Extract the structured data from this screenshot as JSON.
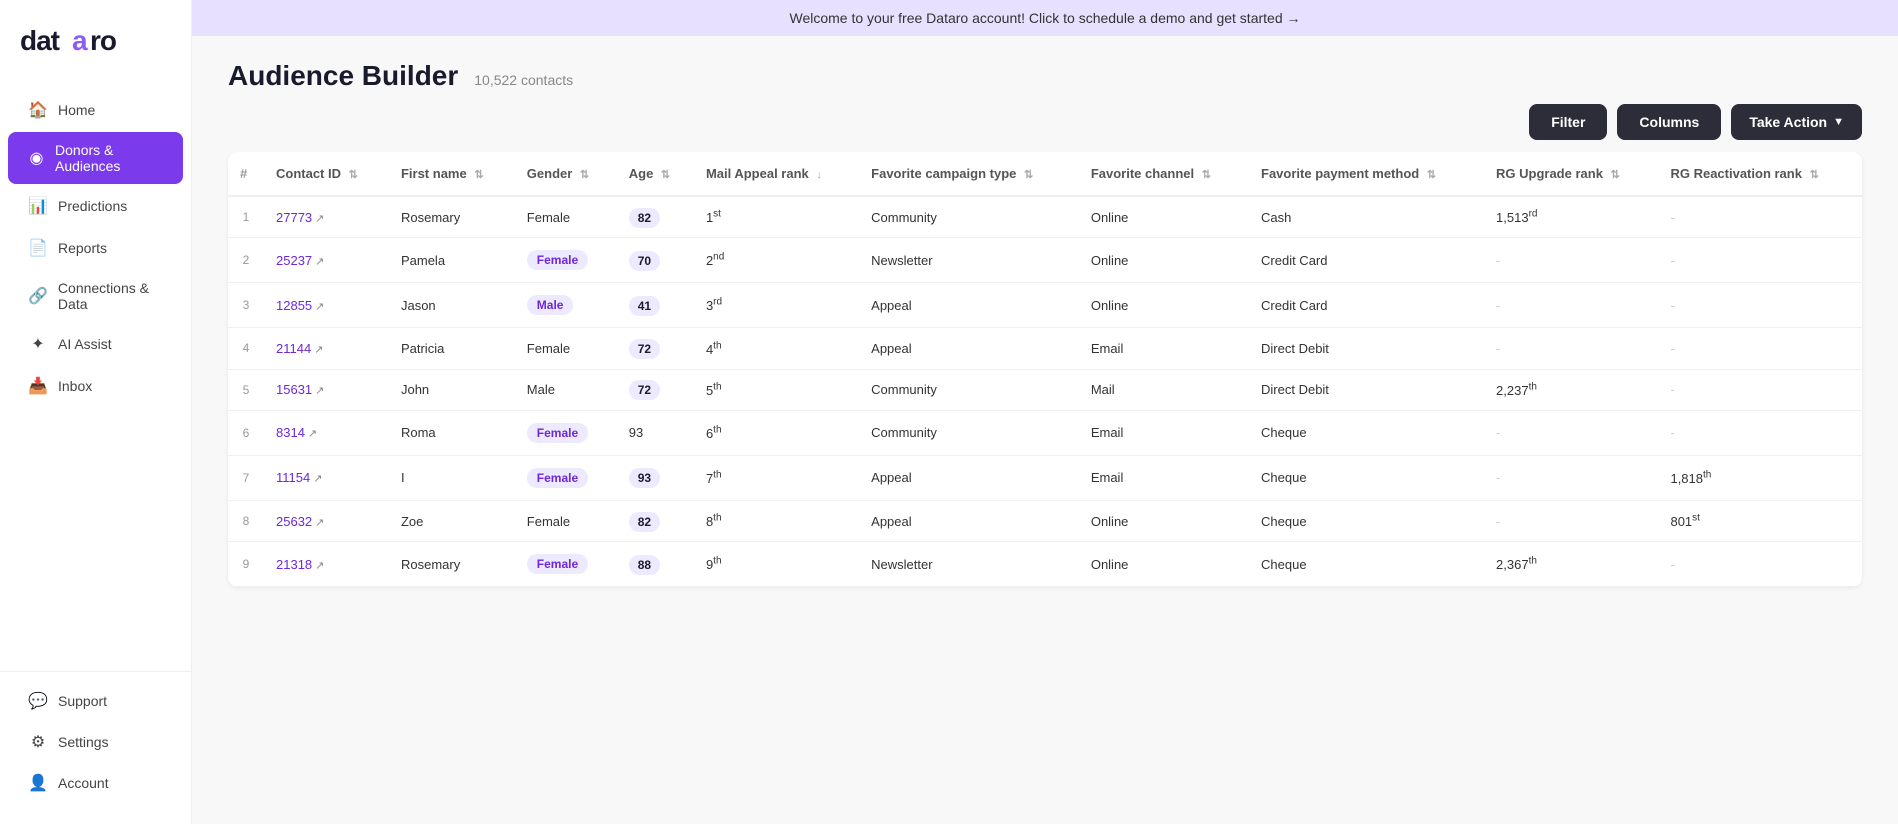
{
  "banner": {
    "text": "Welcome to your free Dataro account! Click to schedule a demo and get started →"
  },
  "sidebar": {
    "logo": "dataro",
    "items": [
      {
        "id": "home",
        "label": "Home",
        "icon": "🏠",
        "active": false
      },
      {
        "id": "donors-audiences",
        "label": "Donors & Audiences",
        "icon": "◉",
        "active": true
      },
      {
        "id": "predictions",
        "label": "Predictions",
        "icon": "📊",
        "active": false
      },
      {
        "id": "reports",
        "label": "Reports",
        "icon": "📄",
        "active": false
      },
      {
        "id": "connections-data",
        "label": "Connections & Data",
        "icon": "🔗",
        "active": false
      },
      {
        "id": "ai-assist",
        "label": "AI Assist",
        "icon": "✦",
        "active": false
      },
      {
        "id": "inbox",
        "label": "Inbox",
        "icon": "📥",
        "active": false
      },
      {
        "id": "support",
        "label": "Support",
        "icon": "⚙",
        "active": false
      },
      {
        "id": "settings",
        "label": "Settings",
        "icon": "⚙",
        "active": false
      },
      {
        "id": "account",
        "label": "Account",
        "icon": "👤",
        "active": false
      }
    ]
  },
  "page": {
    "title": "Audience Builder",
    "contact_count": "10,522 contacts"
  },
  "toolbar": {
    "filter_label": "Filter",
    "columns_label": "Columns",
    "take_action_label": "Take Action"
  },
  "table": {
    "columns": [
      {
        "id": "num",
        "label": "#",
        "sortable": false
      },
      {
        "id": "contact_id",
        "label": "Contact ID",
        "sortable": true
      },
      {
        "id": "first_name",
        "label": "First name",
        "sortable": true
      },
      {
        "id": "gender",
        "label": "Gender",
        "sortable": true
      },
      {
        "id": "age",
        "label": "Age",
        "sortable": true
      },
      {
        "id": "mail_appeal_rank",
        "label": "Mail Appeal rank",
        "sortable": true,
        "sort_dir": "desc"
      },
      {
        "id": "fav_campaign",
        "label": "Favorite campaign type",
        "sortable": true
      },
      {
        "id": "fav_channel",
        "label": "Favorite channel",
        "sortable": true
      },
      {
        "id": "fav_payment",
        "label": "Favorite payment method",
        "sortable": true
      },
      {
        "id": "rg_upgrade",
        "label": "RG Upgrade rank",
        "sortable": true
      },
      {
        "id": "rg_reactivation",
        "label": "RG Reactivation rank",
        "sortable": true
      }
    ],
    "rows": [
      {
        "num": 1,
        "contact_id": "27773",
        "first_name": "Rosemary",
        "gender": "Female",
        "gender_badge": false,
        "age": 82,
        "age_badge": true,
        "mail_rank": "1st",
        "fav_campaign": "Community",
        "fav_channel": "Online",
        "fav_payment": "Cash",
        "rg_upgrade": "1,513rd",
        "rg_reactivation": "-"
      },
      {
        "num": 2,
        "contact_id": "25237",
        "first_name": "Pamela",
        "gender": "Female",
        "gender_badge": true,
        "age": 70,
        "age_badge": true,
        "mail_rank": "2nd",
        "fav_campaign": "Newsletter",
        "fav_channel": "Online",
        "fav_payment": "Credit Card",
        "rg_upgrade": "-",
        "rg_reactivation": "-"
      },
      {
        "num": 3,
        "contact_id": "12855",
        "first_name": "Jason",
        "gender": "Male",
        "gender_badge": true,
        "age": 41,
        "age_badge": true,
        "mail_rank": "3rd",
        "fav_campaign": "Appeal",
        "fav_channel": "Online",
        "fav_payment": "Credit Card",
        "rg_upgrade": "-",
        "rg_reactivation": "-"
      },
      {
        "num": 4,
        "contact_id": "21144",
        "first_name": "Patricia",
        "gender": "Female",
        "gender_badge": false,
        "age": 72,
        "age_badge": true,
        "mail_rank": "4th",
        "fav_campaign": "Appeal",
        "fav_channel": "Email",
        "fav_payment": "Direct Debit",
        "rg_upgrade": "-",
        "rg_reactivation": "-"
      },
      {
        "num": 5,
        "contact_id": "15631",
        "first_name": "John",
        "gender": "Male",
        "gender_badge": false,
        "age": 72,
        "age_badge": true,
        "mail_rank": "5th",
        "fav_campaign": "Community",
        "fav_channel": "Mail",
        "fav_payment": "Direct Debit",
        "rg_upgrade": "2,237th",
        "rg_reactivation": "-"
      },
      {
        "num": 6,
        "contact_id": "8314",
        "first_name": "Roma",
        "gender": "Female",
        "gender_badge": true,
        "age": 93,
        "age_badge": false,
        "mail_rank": "6th",
        "fav_campaign": "Community",
        "fav_channel": "Email",
        "fav_payment": "Cheque",
        "rg_upgrade": "-",
        "rg_reactivation": "-"
      },
      {
        "num": 7,
        "contact_id": "11154",
        "first_name": "I",
        "gender": "Female",
        "gender_badge": true,
        "age": 93,
        "age_badge": true,
        "mail_rank": "7th",
        "fav_campaign": "Appeal",
        "fav_channel": "Email",
        "fav_payment": "Cheque",
        "rg_upgrade": "-",
        "rg_reactivation": "1,818th"
      },
      {
        "num": 8,
        "contact_id": "25632",
        "first_name": "Zoe",
        "gender": "Female",
        "gender_badge": false,
        "age": 82,
        "age_badge": true,
        "mail_rank": "8th",
        "fav_campaign": "Appeal",
        "fav_channel": "Online",
        "fav_payment": "Cheque",
        "rg_upgrade": "-",
        "rg_reactivation": "801st"
      },
      {
        "num": 9,
        "contact_id": "21318",
        "first_name": "Rosemary",
        "gender": "Female",
        "gender_badge": true,
        "age": 88,
        "age_badge": true,
        "mail_rank": "9th",
        "fav_campaign": "Newsletter",
        "fav_channel": "Online",
        "fav_payment": "Cheque",
        "rg_upgrade": "2,367th",
        "rg_reactivation": "-"
      }
    ]
  }
}
